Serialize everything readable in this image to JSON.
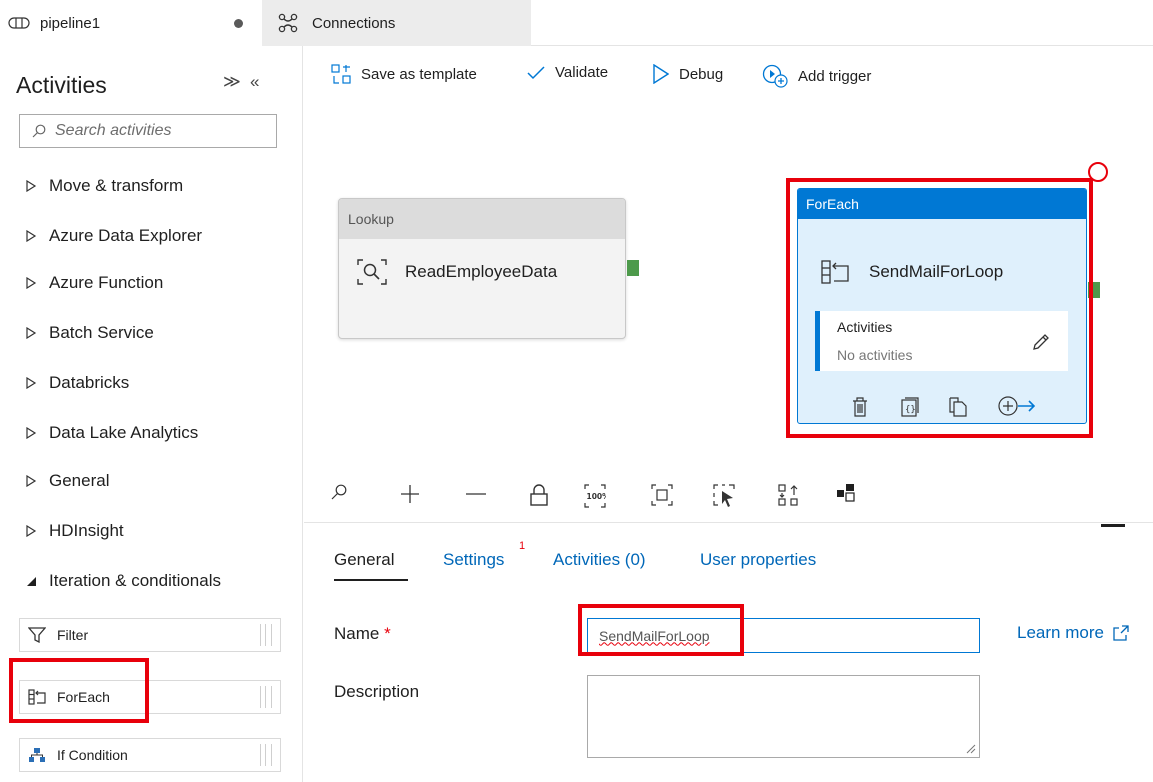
{
  "tabs": {
    "pipeline": {
      "label": "pipeline1",
      "icon": "pipeline-icon",
      "unsaved": true
    },
    "connections": {
      "label": "Connections",
      "icon": "connections-icon"
    }
  },
  "sidebar": {
    "title": "Activities",
    "search_placeholder": "Search activities",
    "categories": [
      {
        "label": "Move & transform",
        "expanded": false
      },
      {
        "label": "Azure Data Explorer",
        "expanded": false
      },
      {
        "label": "Azure Function",
        "expanded": false
      },
      {
        "label": "Batch Service",
        "expanded": false
      },
      {
        "label": "Databricks",
        "expanded": false
      },
      {
        "label": "Data Lake Analytics",
        "expanded": false
      },
      {
        "label": "General",
        "expanded": false
      },
      {
        "label": "HDInsight",
        "expanded": false
      },
      {
        "label": "Iteration & conditionals",
        "expanded": true
      }
    ],
    "activities": [
      {
        "label": "Filter",
        "icon": "filter-icon"
      },
      {
        "label": "ForEach",
        "icon": "foreach-icon"
      },
      {
        "label": "If Condition",
        "icon": "if-condition-icon"
      }
    ]
  },
  "toolbar": {
    "save_template": "Save as template",
    "validate": "Validate",
    "debug": "Debug",
    "add_trigger": "Add trigger"
  },
  "canvas": {
    "lookup": {
      "type": "Lookup",
      "name": "ReadEmployeeData"
    },
    "foreach": {
      "type": "ForEach",
      "name": "SendMailForLoop",
      "activities_label": "Activities",
      "activities_status": "No activities"
    }
  },
  "properties": {
    "tabs": [
      {
        "label": "General",
        "active": true
      },
      {
        "label": "Settings",
        "badge": "1"
      },
      {
        "label": "Activities (0)"
      },
      {
        "label": "User properties"
      }
    ],
    "name_label": "Name",
    "required_mark": "*",
    "name_value": "SendMailForLoop",
    "learn_more": "Learn more",
    "description_label": "Description",
    "description_value": ""
  },
  "colors": {
    "accent": "#0078d4",
    "highlight": "#e8000b",
    "port": "#4d9a4b",
    "link": "#0067b8"
  }
}
